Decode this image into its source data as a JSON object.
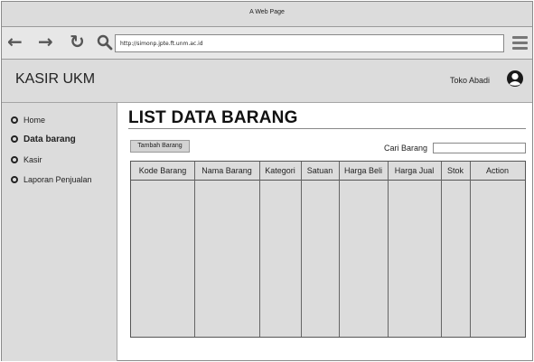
{
  "browser": {
    "window_title": "A Web Page",
    "url": "http://simonp.jpte.ft.unm.ac.id",
    "icons": {
      "back": "arrow-left-icon",
      "forward": "arrow-right-icon",
      "reload": "reload-icon",
      "search": "search-icon",
      "menu": "hamburger-menu-icon"
    }
  },
  "header": {
    "brand": "KASIR UKM",
    "user_name": "Toko Abadi",
    "user_icon": "user-avatar-icon"
  },
  "sidebar": {
    "items": [
      {
        "label": "Home",
        "active": false
      },
      {
        "label": "Data barang",
        "active": true
      },
      {
        "label": "Kasir",
        "active": false
      },
      {
        "label": "Laporan Penjualan",
        "active": false
      }
    ]
  },
  "main": {
    "title": "LIST DATA BARANG",
    "add_button": "Tambah Barang",
    "search_label": "Cari Barang",
    "search_value": "",
    "table": {
      "columns": [
        "Kode Barang",
        "Nama Barang",
        "Kategori",
        "Satuan",
        "Harga Beli",
        "Harga Jual",
        "Stok",
        "Action"
      ],
      "rows": []
    }
  },
  "colors": {
    "panel": "#dcdcdc",
    "border": "#8a8a8a",
    "text": "#222222"
  }
}
